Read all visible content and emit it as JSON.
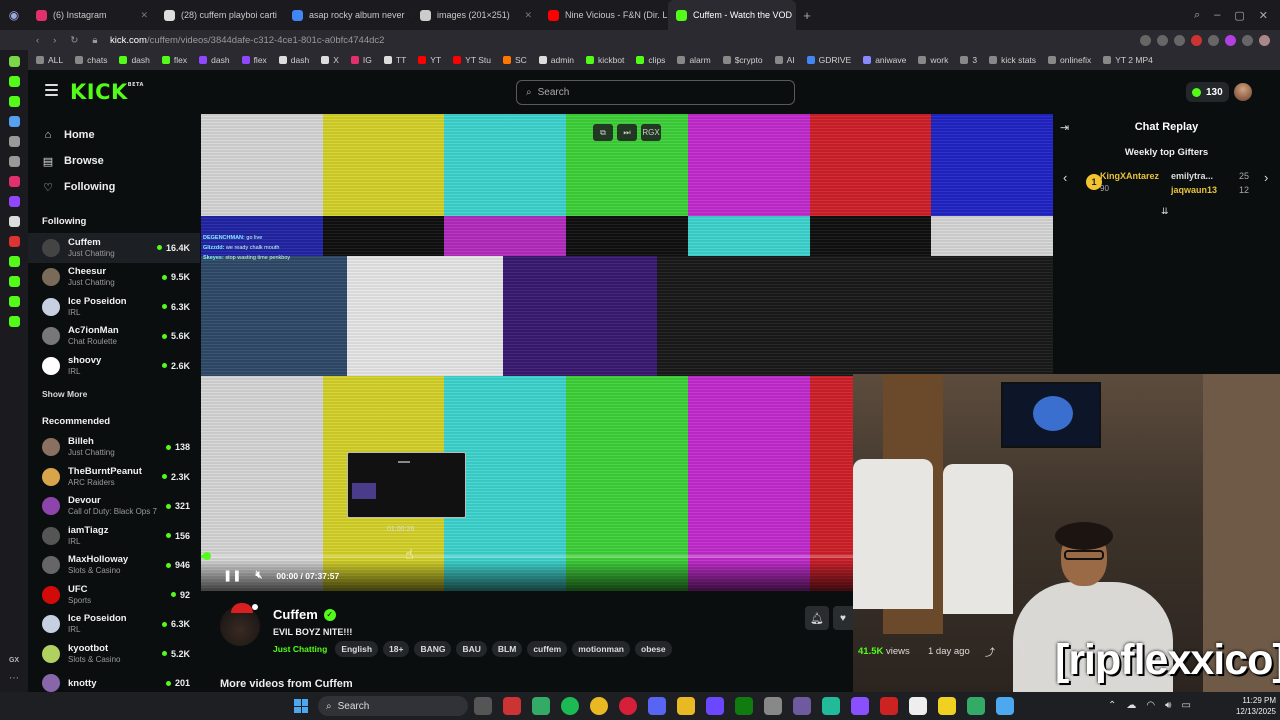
{
  "browser": {
    "tabs": [
      {
        "title": "(6) Instagram",
        "color": "#e1306c"
      },
      {
        "title": "(28) cuffem playboi carti",
        "color": "#dddddd"
      },
      {
        "title": "asap rocky album never",
        "color": "#4285f4"
      },
      {
        "title": "images (201×251)",
        "color": "#cccccc"
      },
      {
        "title": "Nine Vicious - F&N (Dir. L",
        "color": "#ff0000"
      },
      {
        "title": "Cuffem - Watch the VOD",
        "color": "#53fc18"
      }
    ],
    "url_host": "kick.com",
    "url_path": "/cuffem/videos/3844dafe-c312-4ce1-801c-a0bfc4744dc2",
    "bookmarks": [
      {
        "label": "ALL",
        "color": "#888888"
      },
      {
        "label": "chats",
        "color": "#888888"
      },
      {
        "label": "dash",
        "color": "#53fc18"
      },
      {
        "label": "flex",
        "color": "#53fc18"
      },
      {
        "label": "dash",
        "color": "#9146ff"
      },
      {
        "label": "flex",
        "color": "#9146ff"
      },
      {
        "label": "dash",
        "color": "#dddddd"
      },
      {
        "label": "X",
        "color": "#dddddd"
      },
      {
        "label": "IG",
        "color": "#e1306c"
      },
      {
        "label": "TT",
        "color": "#dddddd"
      },
      {
        "label": "YT",
        "color": "#ff0000"
      },
      {
        "label": "YT Stu",
        "color": "#ff0000"
      },
      {
        "label": "SC",
        "color": "#ff7700"
      },
      {
        "label": "admin",
        "color": "#dddddd"
      },
      {
        "label": "kickbot",
        "color": "#53fc18"
      },
      {
        "label": "clips",
        "color": "#53fc18"
      },
      {
        "label": "alarm",
        "color": "#888888"
      },
      {
        "label": "$crypto",
        "color": "#888888"
      },
      {
        "label": "AI",
        "color": "#888888"
      },
      {
        "label": "GDRIVE",
        "color": "#4285f4"
      },
      {
        "label": "aniwave",
        "color": "#8888ff"
      },
      {
        "label": "work",
        "color": "#888888"
      },
      {
        "label": "3",
        "color": "#888888"
      },
      {
        "label": "kick stats",
        "color": "#888888"
      },
      {
        "label": "onlinefix",
        "color": "#888888"
      },
      {
        "label": "YT 2 MP4",
        "color": "#888888"
      }
    ]
  },
  "header": {
    "logo": "KICK",
    "logo_beta": "BETA",
    "search_placeholder": "Search",
    "coins": "130"
  },
  "nav": {
    "home": "Home",
    "browse": "Browse",
    "following": "Following"
  },
  "following_title": "Following",
  "following": [
    {
      "name": "Cuffem",
      "category": "Just Chatting",
      "viewers": "16.4K",
      "color": "#444444"
    },
    {
      "name": "Cheesur",
      "category": "Just Chatting",
      "viewers": "9.5K",
      "color": "#7a6a5a"
    },
    {
      "name": "Ice Poseidon",
      "category": "IRL",
      "viewers": "6.3K",
      "color": "#c7d0e0"
    },
    {
      "name": "Ac7ionMan",
      "category": "Chat Roulette",
      "viewers": "5.6K",
      "color": "#777777"
    },
    {
      "name": "shoovy",
      "category": "IRL",
      "viewers": "2.6K",
      "color": "#ffffff"
    }
  ],
  "show_more": "Show More",
  "recommended_title": "Recommended",
  "recommended": [
    {
      "name": "Billeh",
      "category": "Just Chatting",
      "viewers": "138",
      "color": "#8a7060"
    },
    {
      "name": "TheBurntPeanut",
      "category": "ARC Raiders",
      "viewers": "2.3K",
      "color": "#d9a54a"
    },
    {
      "name": "Devour",
      "category": "Call of Duty: Black Ops 7",
      "viewers": "321",
      "color": "#8e44ad"
    },
    {
      "name": "iamTiagz",
      "category": "IRL",
      "viewers": "156",
      "color": "#555555"
    },
    {
      "name": "MaxHolloway",
      "category": "Slots & Casino",
      "viewers": "946",
      "color": "#666666"
    },
    {
      "name": "UFC",
      "category": "Sports",
      "viewers": "92",
      "color": "#d20a0a"
    },
    {
      "name": "Ice Poseidon",
      "category": "IRL",
      "viewers": "6.3K",
      "color": "#c7d0e0"
    },
    {
      "name": "kyootbot",
      "category": "Slots & Casino",
      "viewers": "5.2K",
      "color": "#b0d060"
    },
    {
      "name": "knotty",
      "category": "",
      "viewers": "201",
      "color": "#8866aa"
    }
  ],
  "player": {
    "btn_rgx": "RGX",
    "chat_lines": [
      {
        "user": "DEGENCHMAN:",
        "msg": "go live"
      },
      {
        "user": "Glizzdd:",
        "msg": "we ready chalk mouth"
      },
      {
        "user": "Skeyes:",
        "msg": "stop wasting time penkboy"
      }
    ],
    "preview_time": "01:00:26",
    "time_current": "00:00",
    "time_total": "07:37:57",
    "progress": 0.005
  },
  "chat": {
    "title": "Chat Replay",
    "gifters_title": "Weekly top Gifters",
    "gifter1_rank": "1",
    "gifter1_name": "KingXAntarez",
    "gifter1_value": "90",
    "gifter2_name": "emilytra...",
    "gifter2_value": "25",
    "gifter3_name": "jaqwaun13",
    "gifter3_value": "12"
  },
  "webcam_label": "[ripflexxico]",
  "stream": {
    "channel": "Cuffem",
    "title": "EVIL BOYZ NITE!!!",
    "category": "Just Chatting",
    "tags": [
      "English",
      "18+",
      "BANG",
      "BAU",
      "BLM",
      "cuffem",
      "motionman",
      "obese"
    ],
    "views": "41.5K",
    "views_label": "views",
    "ago": "1 day ago",
    "more_videos": "More videos from Cuffem"
  },
  "taskbar": {
    "search": "Search",
    "time": "11:29 PM",
    "date": "12/13/2025"
  },
  "colors": {
    "accent": "#53fc18",
    "background": "#0b0e0f"
  }
}
